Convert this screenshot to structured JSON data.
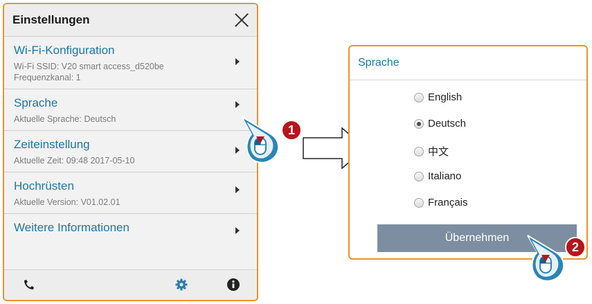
{
  "settings": {
    "title": "Einstellungen",
    "items": [
      {
        "label": "Wi-Fi-Konfiguration",
        "sub1": "Wi-Fi SSID: V20 smart access_d520be",
        "sub2": "Frequenzkanal: 1"
      },
      {
        "label": "Sprache",
        "sub1": "Aktuelle Sprache: Deutsch"
      },
      {
        "label": "Zeiteinstellung",
        "sub1": "Aktuelle Zeit: 09:48 2017-05-10"
      },
      {
        "label": "Hochrüsten",
        "sub1": "Aktuelle Version: V01.02.01"
      },
      {
        "label": "Weitere Informationen"
      }
    ],
    "footer_icons": [
      "phone-icon",
      "gear-icon",
      "info-icon"
    ]
  },
  "language_dialog": {
    "title": "Sprache",
    "options": [
      "English",
      "Deutsch",
      "中文",
      "Italiano",
      "Français"
    ],
    "selected": "Deutsch",
    "apply_label": "Übernehmen"
  },
  "callouts": [
    "1",
    "2"
  ],
  "colors": {
    "accent_orange": "#e8952e",
    "link_blue": "#1d77a6",
    "button_gray": "#7c8ea0",
    "callout_red": "#b5161b",
    "cursor_blue": "#2a86b5"
  }
}
